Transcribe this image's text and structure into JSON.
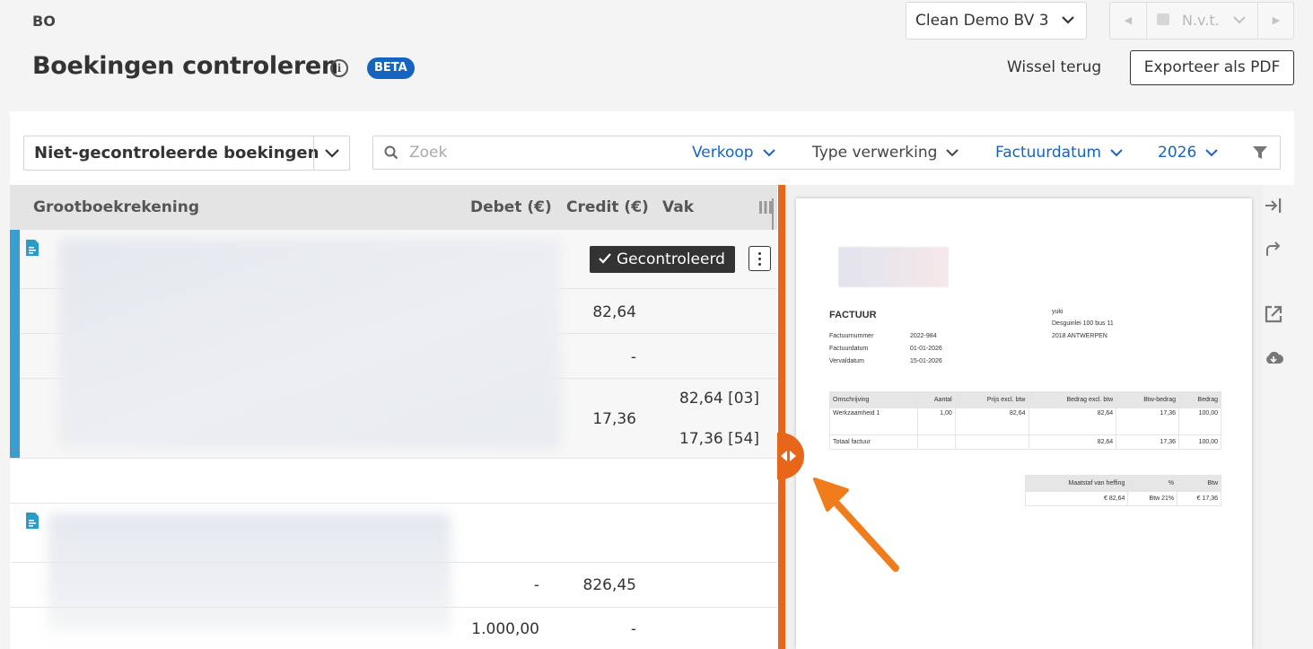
{
  "header": {
    "org_code": "BO",
    "title": "Boekingen controleren",
    "beta": "BETA",
    "company": "Clean Demo BV 3",
    "period": "N.v.t.",
    "switch_back": "Wissel terug",
    "export": "Exporteer als PDF"
  },
  "filters": {
    "status": "Niet-gecontroleerde boekingen",
    "search_placeholder": "Zoek",
    "type": "Verkoop",
    "processing": "Type verwerking",
    "date_field": "Factuurdatum",
    "year": "2026"
  },
  "table": {
    "columns": [
      "Grootboekrekening",
      "Debet (€)",
      "Credit (€)",
      "Vak"
    ],
    "group1": {
      "status": "Gecontroleerd",
      "rows": [
        {
          "credit": "82,64"
        },
        {
          "credit": "-"
        },
        {
          "credit": "17,36",
          "vak1": "82,64 [03]",
          "vak2": "17,36 [54]"
        }
      ]
    },
    "group2": {
      "rows": [
        {
          "debit": "-",
          "credit": "826,45"
        },
        {
          "debit": "1.000,00",
          "credit": "-"
        }
      ]
    }
  },
  "invoice": {
    "title": "FACTUUR",
    "company": "yuki",
    "address1": "Desguinlei 100 bus 11",
    "address2": "2018 ANTWERPEN",
    "meta": [
      {
        "label": "Factuurnummer",
        "value": "2022-984"
      },
      {
        "label": "Factuurdatum",
        "value": "01-01-2026"
      },
      {
        "label": "Vervaldatum",
        "value": "15-01-2026"
      }
    ],
    "lines_header": [
      "Omschrijving",
      "Aantal",
      "Prijs excl. btw",
      "Bedrag excl. btw",
      "Btw-bedrag",
      "Bedrag"
    ],
    "lines": [
      [
        "Werkzaamheid 1",
        "1,00",
        "82,64",
        "82,64",
        "17,36",
        "100,00"
      ]
    ],
    "total": [
      "Totaal factuur",
      "",
      "",
      "82,64",
      "17,36",
      "100,00"
    ],
    "vat_header": [
      "Maatstaf van heffing",
      "%",
      "Btw"
    ],
    "vat_row": [
      "€ 82,64",
      "Btw 21%",
      "€ 17,36"
    ]
  },
  "colors": {
    "accent_blue": "#1565c0",
    "row_marker": "#3a9fd0",
    "splitter": "#e8661a",
    "doc_icon": "#2a9bc9"
  },
  "icons": [
    "info-icon",
    "chevron-down-icon",
    "calendar-icon",
    "search-icon",
    "filter-icon",
    "columns-icon",
    "document-icon",
    "check-icon",
    "more-vertical-icon",
    "collapse-right-icon",
    "redirect-icon",
    "open-external-icon",
    "cloud-download-icon"
  ]
}
